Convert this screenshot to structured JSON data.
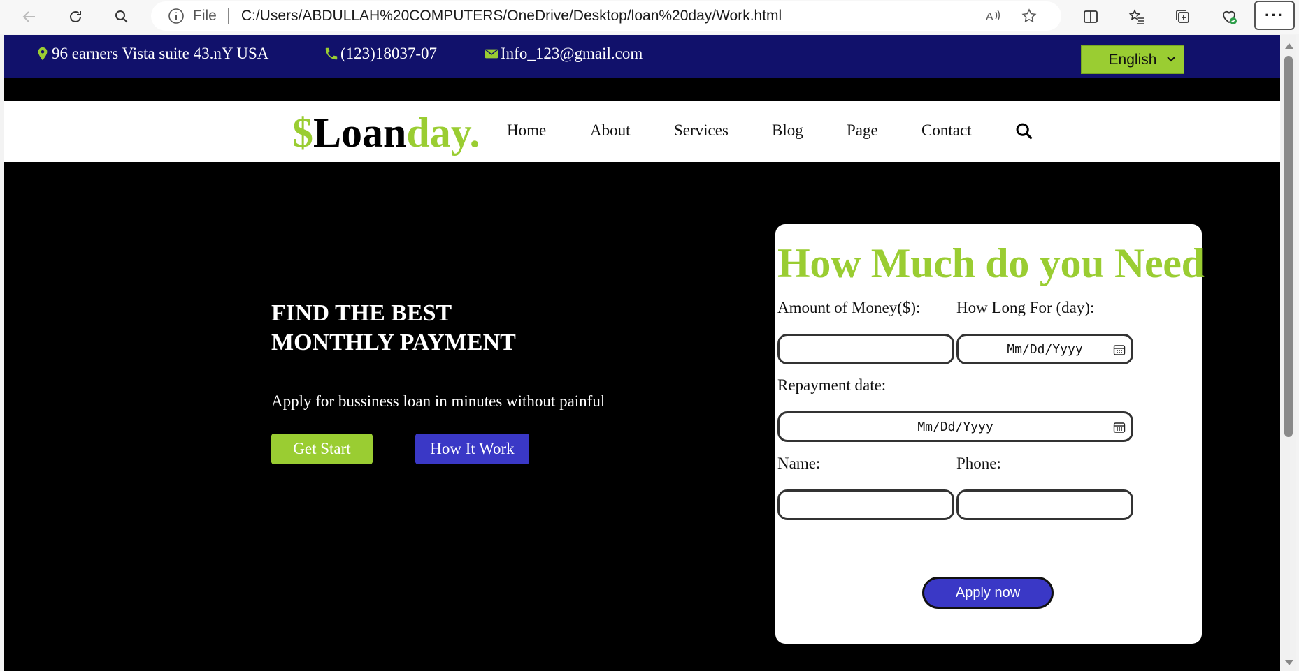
{
  "browser": {
    "file_label": "File",
    "url": "C:/Users/ABDULLAH%20COMPUTERS/OneDrive/Desktop/loan%20day/Work.html",
    "menu_label": "···"
  },
  "topbar": {
    "address": "96 earners Vista suite 43.nY USA",
    "phone": "(123)18037-07",
    "email": "Info_123@gmail.com",
    "language": "English"
  },
  "nav": {
    "logo_dollar": "$",
    "logo_loan": "Loan",
    "logo_day": "day.",
    "links": [
      "Home",
      "About",
      "Services",
      "Blog",
      "Page",
      "Contact"
    ]
  },
  "hero": {
    "title_line1": "FIND THE BEST",
    "title_line2": "MONTHLY PAYMENT",
    "subtitle": "Apply for bussiness loan in minutes without painful",
    "start_label": "Get Start",
    "how_label": "How It Work"
  },
  "form": {
    "heading": "How Much do you Need",
    "amount_label": "Amount of Money($):",
    "amount_value": "",
    "howlong_label": "How Long For (day):",
    "howlong_placeholder": "Mm/Dd/Yyyy",
    "repayment_label": "Repayment date:",
    "repayment_placeholder": "Mm/Dd/Yyyy",
    "name_label": "Name:",
    "name_value": "",
    "phone_label": "Phone:",
    "phone_value": "",
    "apply_label": "Apply now"
  },
  "colors": {
    "accent_green": "#9acd32",
    "topbar_navy": "#11116b",
    "button_blue": "#3a38c6"
  }
}
